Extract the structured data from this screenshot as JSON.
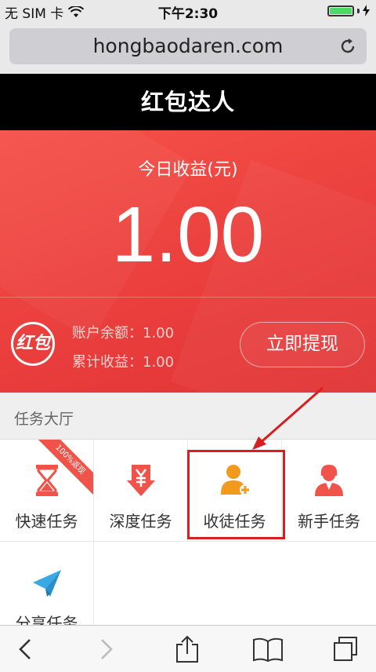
{
  "status_bar": {
    "carrier": "无 SIM 卡",
    "time": "下午2:30",
    "battery_level": 1.0
  },
  "browser": {
    "url": "hongbaodaren.com",
    "reload_icon": "reload-icon"
  },
  "header": {
    "title": "红包达人"
  },
  "earnings": {
    "today_label": "今日收益(元)",
    "today_value": "1.00",
    "badge_text": "红包",
    "account_balance_label": "账户余额：",
    "account_balance_value": "1.00",
    "total_income_label": "累计收益：",
    "total_income_value": "1.00",
    "withdraw_label": "立即提现"
  },
  "task_hall": {
    "title": "任务大厅",
    "tasks": [
      {
        "label": "快速任务",
        "icon": "hourglass-icon",
        "ribbon": "100%返现"
      },
      {
        "label": "深度任务",
        "icon": "yen-download-icon"
      },
      {
        "label": "收徒任务",
        "icon": "add-user-icon"
      },
      {
        "label": "新手任务",
        "icon": "newbie-user-icon"
      },
      {
        "label": "分享任务",
        "icon": "paper-plane-icon"
      }
    ]
  },
  "colors": {
    "brand_red": "#ea3f3d",
    "highlight_red": "#d71f1f",
    "icon_red": "#f0534a",
    "icon_orange": "#f39a1e",
    "icon_blue": "#3aa8e6"
  },
  "toolbar": {
    "icons": [
      "back-icon",
      "forward-icon",
      "share-icon",
      "bookmarks-icon",
      "tabs-icon"
    ]
  }
}
